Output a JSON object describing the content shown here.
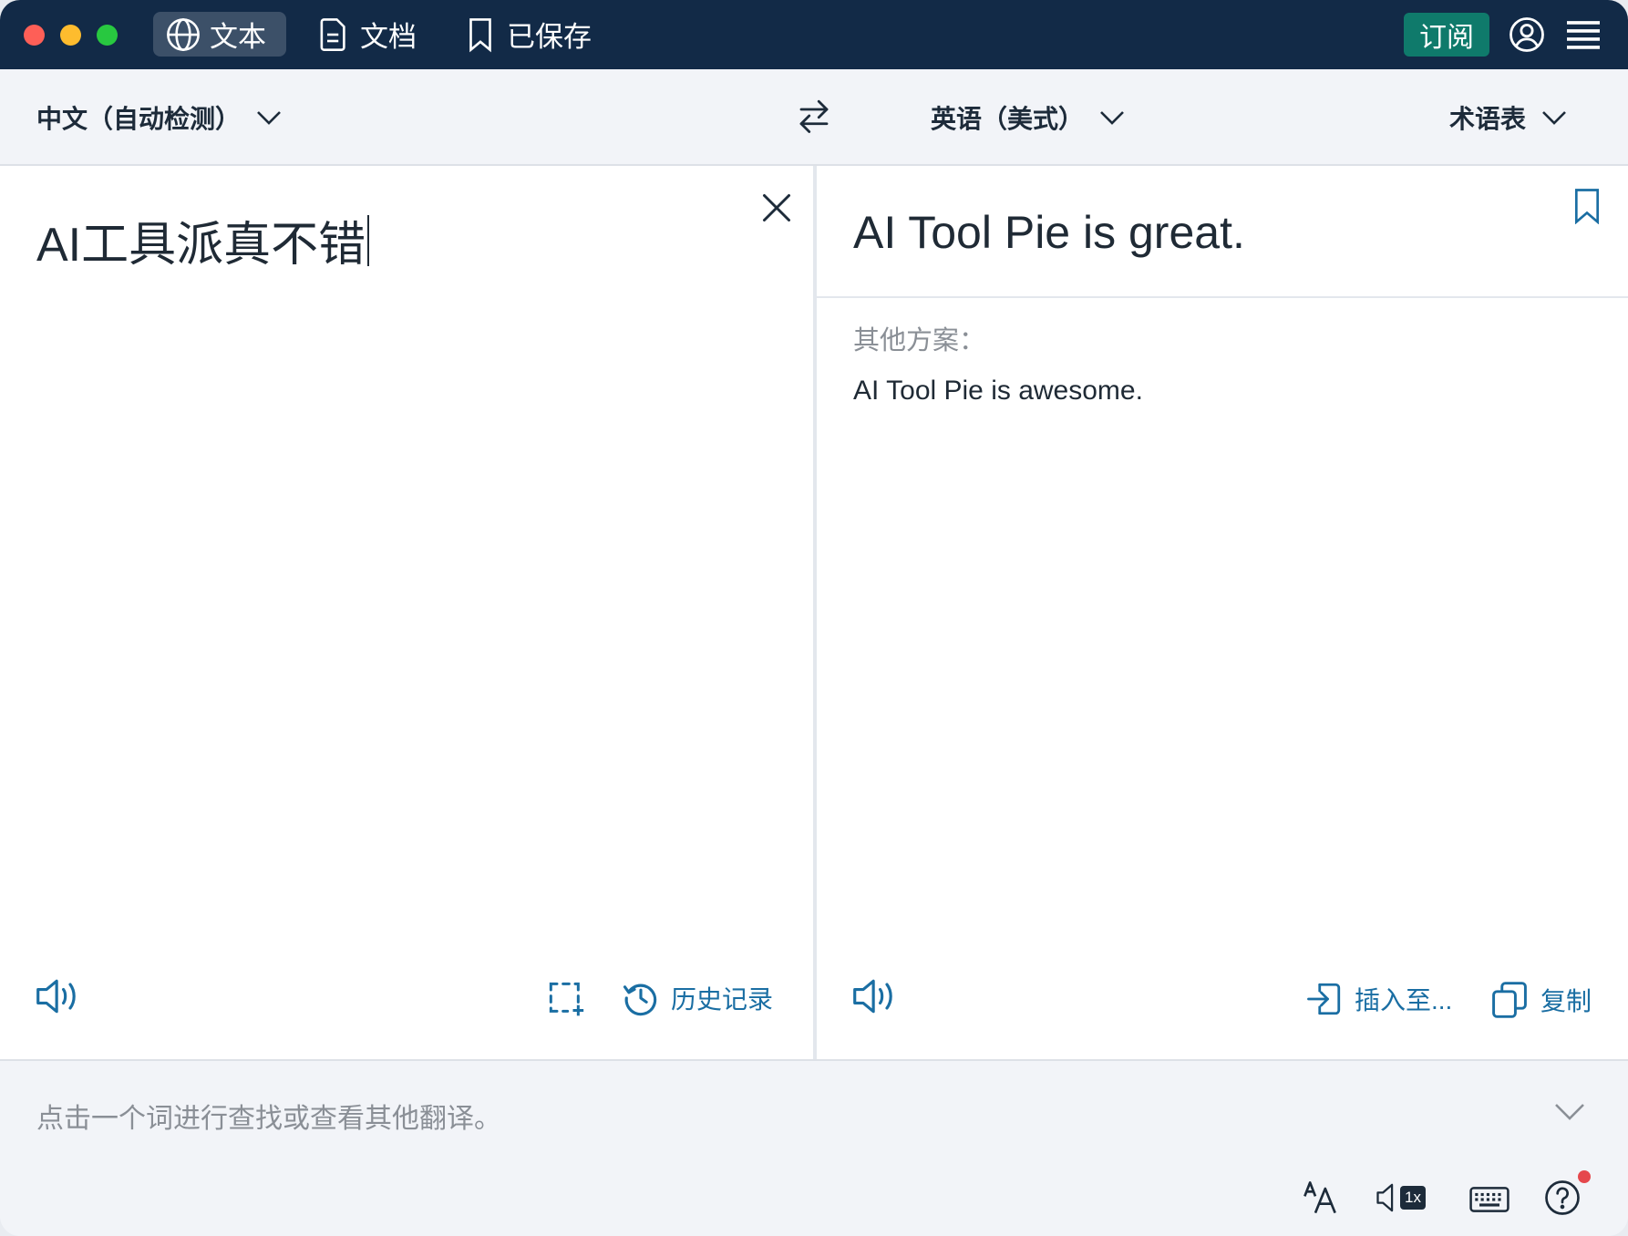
{
  "titlebar": {
    "tabs": [
      {
        "label": "文本",
        "icon": "globe-icon",
        "active": true
      },
      {
        "label": "文档",
        "icon": "document-icon",
        "active": false
      },
      {
        "label": "已保存",
        "icon": "bookmark-icon",
        "active": false
      }
    ],
    "subscribe_label": "订阅",
    "account_icon": "account-icon",
    "menu_icon": "hamburger-menu-icon",
    "colors": {
      "background": "#122a47",
      "subscribe": "#0f7a6b"
    }
  },
  "language_bar": {
    "source_language": "中文（自动检测）",
    "target_language": "英语（美式）",
    "glossary_label": "术语表",
    "swap_icon": "swap-arrows-icon"
  },
  "source_panel": {
    "text": "AI工具派真不错",
    "clear_icon": "close-icon",
    "speak_icon": "speaker-icon",
    "crop_icon": "screen-capture-icon",
    "history_label": "历史记录"
  },
  "target_panel": {
    "text": "AI Tool Pie is great.",
    "alternatives_label": "其他方案：",
    "alternatives": [
      "AI Tool Pie is awesome."
    ],
    "insert_label": "插入至...",
    "copy_label": "复制",
    "accent_color": "#1a6ea3"
  },
  "bottom": {
    "hint": "点击一个词进行查找或查看其他翻译。",
    "speed_label": "1x",
    "tools": [
      "font-size-icon",
      "speech-speed-icon",
      "keyboard-icon",
      "help-icon"
    ],
    "notification_color": "#e5484d"
  }
}
